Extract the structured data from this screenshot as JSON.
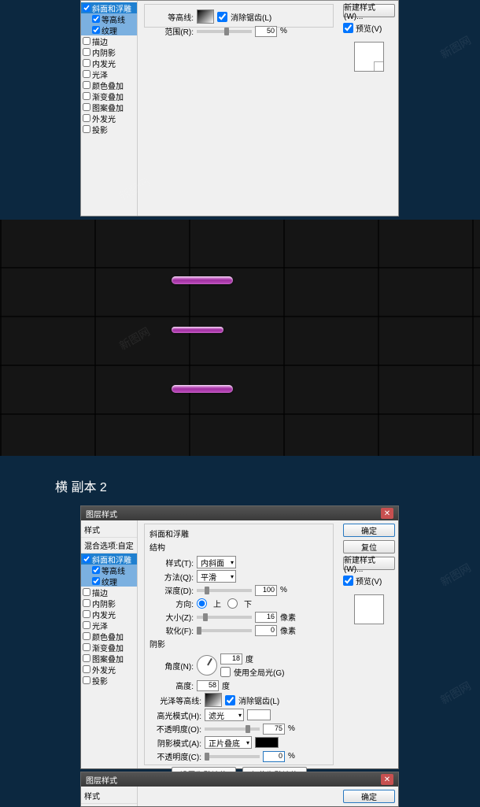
{
  "watermark": "新图网",
  "dialog1": {
    "styles_list": {
      "items": [
        {
          "label": "斜面和浮雕",
          "checked": true,
          "selected": true
        },
        {
          "label": "等高线",
          "checked": true,
          "sub": true
        },
        {
          "label": "纹理",
          "checked": true,
          "sub": true,
          "subselected": true
        },
        {
          "label": "描边",
          "checked": false
        },
        {
          "label": "内阴影",
          "checked": false
        },
        {
          "label": "内发光",
          "checked": false
        },
        {
          "label": "光泽",
          "checked": false
        },
        {
          "label": "颜色叠加",
          "checked": false
        },
        {
          "label": "渐变叠加",
          "checked": false
        },
        {
          "label": "图案叠加",
          "checked": false
        },
        {
          "label": "外发光",
          "checked": false
        },
        {
          "label": "投影",
          "checked": false
        }
      ]
    },
    "main": {
      "contour_label": "等高线:",
      "antialias_label": "消除锯齿(L)",
      "range_label": "范围(R):",
      "range_value": "50",
      "percent": "%"
    },
    "right": {
      "new_style": "新建样式(W)...",
      "preview_label": "预览(V)"
    }
  },
  "section_title": "横 副本 2",
  "dialog2": {
    "title": "图层样式",
    "styles_list": {
      "header1": "样式",
      "header2": "混合选项:自定",
      "items": [
        {
          "label": "斜面和浮雕",
          "checked": true,
          "selected": true
        },
        {
          "label": "等高线",
          "checked": true,
          "sub": true,
          "subselected": true
        },
        {
          "label": "纹理",
          "checked": true,
          "sub": true,
          "subselected": true
        },
        {
          "label": "描边",
          "checked": false
        },
        {
          "label": "内阴影",
          "checked": false
        },
        {
          "label": "内发光",
          "checked": false
        },
        {
          "label": "光泽",
          "checked": false
        },
        {
          "label": "颜色叠加",
          "checked": false
        },
        {
          "label": "渐变叠加",
          "checked": false
        },
        {
          "label": "图案叠加",
          "checked": false
        },
        {
          "label": "外发光",
          "checked": false
        },
        {
          "label": "投影",
          "checked": false
        }
      ]
    },
    "main": {
      "title": "斜面和浮雕",
      "subtitle": "结构",
      "style_label": "样式(T):",
      "style_value": "内斜面",
      "method_label": "方法(Q):",
      "method_value": "平滑",
      "depth_label": "深度(D):",
      "depth_value": "100",
      "direction_label": "方向:",
      "dir_up": "上",
      "dir_down": "下",
      "size_label": "大小(Z):",
      "size_value": "16",
      "size_unit": "像素",
      "soften_label": "软化(F):",
      "soften_value": "0",
      "soften_unit": "像素",
      "shading_title": "阴影",
      "angle_label": "角度(N):",
      "angle_value": "18",
      "angle_unit": "度",
      "global_light": "使用全局光(G)",
      "altitude_label": "高度:",
      "altitude_value": "58",
      "altitude_unit": "度",
      "gloss_contour_label": "光泽等高线:",
      "antialias_label": "消除锯齿(L)",
      "highlight_mode_label": "高光模式(H):",
      "highlight_mode_value": "滤光",
      "opacity1_label": "不透明度(O):",
      "opacity1_value": "75",
      "shadow_mode_label": "阴影模式(A):",
      "shadow_mode_value": "正片叠底",
      "opacity2_label": "不透明度(C):",
      "opacity2_value": "0",
      "percent": "%",
      "make_default": "设置为默认值",
      "reset_default": "复位为默认值"
    },
    "right": {
      "ok": "确定",
      "cancel": "复位",
      "new_style": "新建样式(W)...",
      "preview_label": "预览(V)"
    }
  },
  "dialog3": {
    "title": "图层样式",
    "header1": "样式",
    "ok": "确定"
  }
}
